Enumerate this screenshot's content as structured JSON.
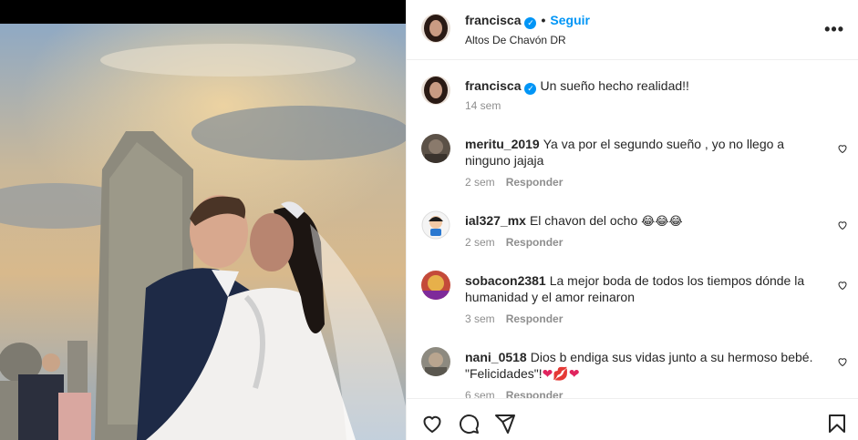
{
  "post": {
    "username": "francisca",
    "follow_label": "Seguir",
    "location": "Altos De Chavón DR",
    "more_icon": "more-icon",
    "caption": "Un sueño hecho realidad!!",
    "caption_time": "14 sem"
  },
  "comments": [
    {
      "user": "meritu_2019",
      "text": "Ya va por el segundo sueño , yo no llego a ninguno jajaja",
      "time": "2 sem",
      "reply": "Responder"
    },
    {
      "user": "ial327_mx",
      "text": "El chavon del ocho",
      "emojis": "😂😂😂",
      "time": "2 sem",
      "reply": "Responder"
    },
    {
      "user": "sobacon2381",
      "text": "La mejor boda de todos los tiempos dónde la humanidad y el amor reinaron",
      "time": "3 sem",
      "reply": "Responder"
    },
    {
      "user": "nani_0518",
      "text": "Dios b endiga sus vidas junto a su hermoso bebé. \"Felicidades\"!",
      "emojis": "❤💋❤",
      "time": "6 sem",
      "reply": "Responder"
    }
  ],
  "colors": {
    "accent": "#0095f6",
    "muted": "#8e8e8e",
    "border": "#efefef"
  },
  "icons": [
    "heart-icon",
    "comment-icon",
    "share-icon",
    "save-icon",
    "verified-icon"
  ]
}
